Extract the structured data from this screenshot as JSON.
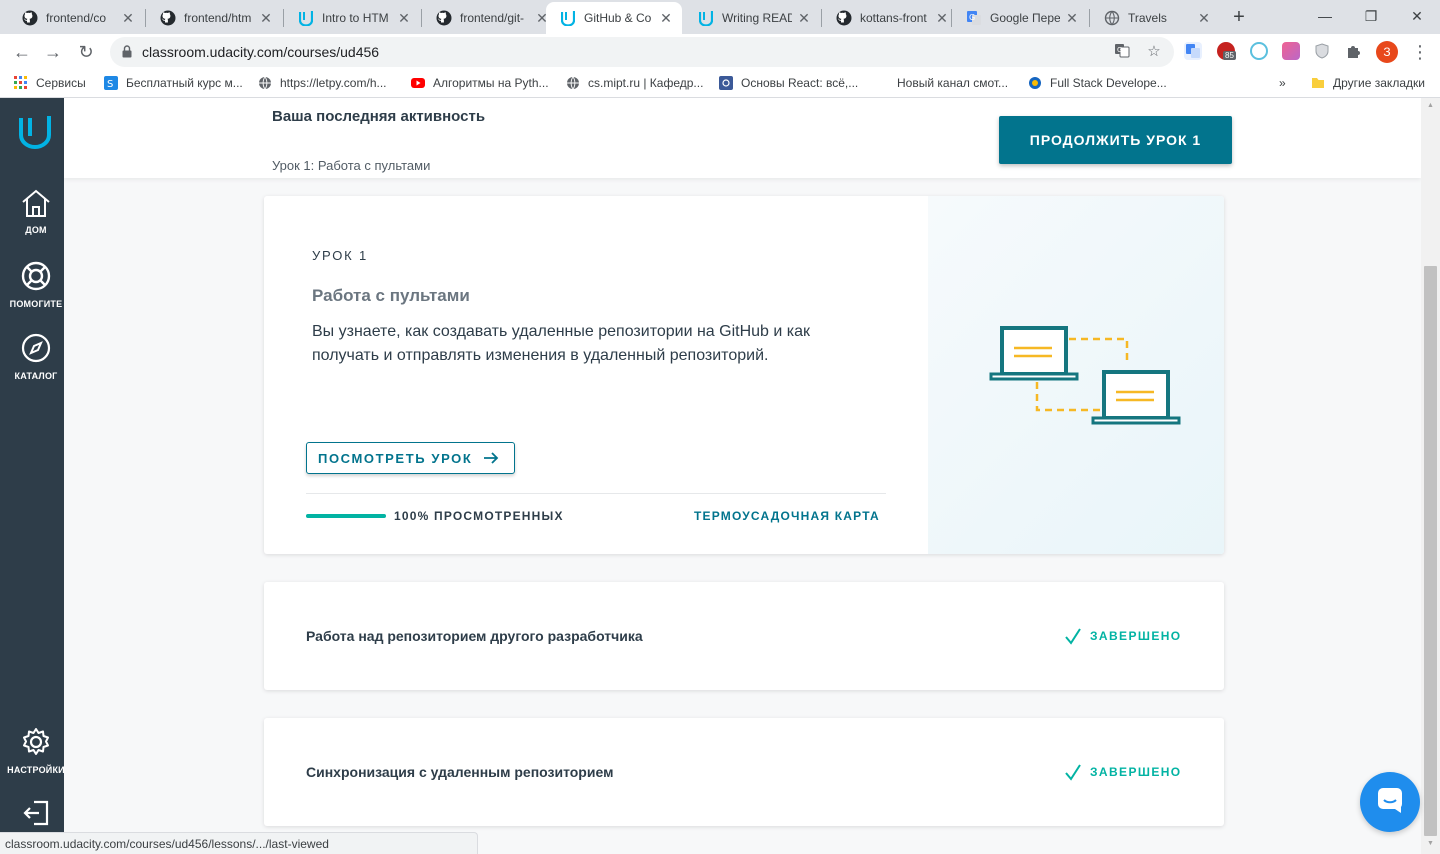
{
  "browser": {
    "tabs": [
      {
        "title": "frontend/co",
        "icon": "github-icon"
      },
      {
        "title": "frontend/htm",
        "icon": "github-icon"
      },
      {
        "title": "Intro to HTM",
        "icon": "udacity-icon"
      },
      {
        "title": "frontend/git-",
        "icon": "github-icon"
      },
      {
        "title": "GitHub & Co",
        "icon": "udacity-icon",
        "active": true
      },
      {
        "title": "Writing READ",
        "icon": "udacity-icon"
      },
      {
        "title": "kottans-front",
        "icon": "github-icon"
      },
      {
        "title": "Google Пере",
        "icon": "google-translate-icon"
      },
      {
        "title": "Travels",
        "icon": "globe-icon"
      }
    ],
    "url": "classroom.udacity.com/courses/ud456",
    "profile_initial": "З",
    "extension_badge": "85",
    "bookmarks": [
      {
        "label": "Сервисы",
        "icon": "apps-grid-icon"
      },
      {
        "label": "Бесплатный курс м...",
        "icon": "skillbox-icon"
      },
      {
        "label": "https://letpy.com/h...",
        "icon": "globe-icon"
      },
      {
        "label": "Алгоритмы на Pyth...",
        "icon": "youtube-icon"
      },
      {
        "label": "cs.mipt.ru | Кафедр...",
        "icon": "globe-icon"
      },
      {
        "label": "Основы React: всё,...",
        "icon": "react-site-icon"
      },
      {
        "label": "Новый канал смот...",
        "icon": ""
      },
      {
        "label": "Full Stack Develope...",
        "icon": "fullstack-icon"
      }
    ],
    "other_bookmarks": "Другие закладки",
    "status_url": "classroom.udacity.com/courses/ud456/lessons/.../last-viewed"
  },
  "sidebar": {
    "items": [
      {
        "label": "ДОМ",
        "icon": "home-icon"
      },
      {
        "label": "ПОМОГИТЕ",
        "icon": "lifebuoy-icon"
      },
      {
        "label": "КАТАЛОГ",
        "icon": "compass-icon"
      },
      {
        "label": "НАСТРОЙКИ",
        "icon": "gear-icon"
      }
    ]
  },
  "activity": {
    "title": "Ваша последняя активность",
    "subtitle": "Урок 1: Работа с пультами",
    "continue_label": "ПРОДОЛЖИТЬ УРОК 1"
  },
  "lesson": {
    "kicker": "УРОК 1",
    "title": "Работа с пультами",
    "description": "Вы узнаете, как создавать удаленные репозитории на GitHub и как получать и отправлять изменения в удаленный репозиторий.",
    "view_label": "ПОСМОТРЕТЬ УРОК",
    "progress_fraction": 1.0,
    "progress_text": "100% ПРОСМОТРЕННЫХ",
    "map_label": "ТЕРМОУСАДОЧНАЯ КАРТА"
  },
  "concepts": [
    {
      "title": "Работа над репозиторием другого разработчика",
      "status": "ЗАВЕРШЕНО"
    },
    {
      "title": "Синхронизация с удаленным репозиторием",
      "status": "ЗАВЕРШЕНО"
    }
  ],
  "colors": {
    "brand": "#02748d",
    "success": "#02b3a3",
    "sidebar": "#2e3d49",
    "illustration_teal": "#15767f",
    "illustration_orange": "#f6b824",
    "chat": "#1f8ded"
  }
}
